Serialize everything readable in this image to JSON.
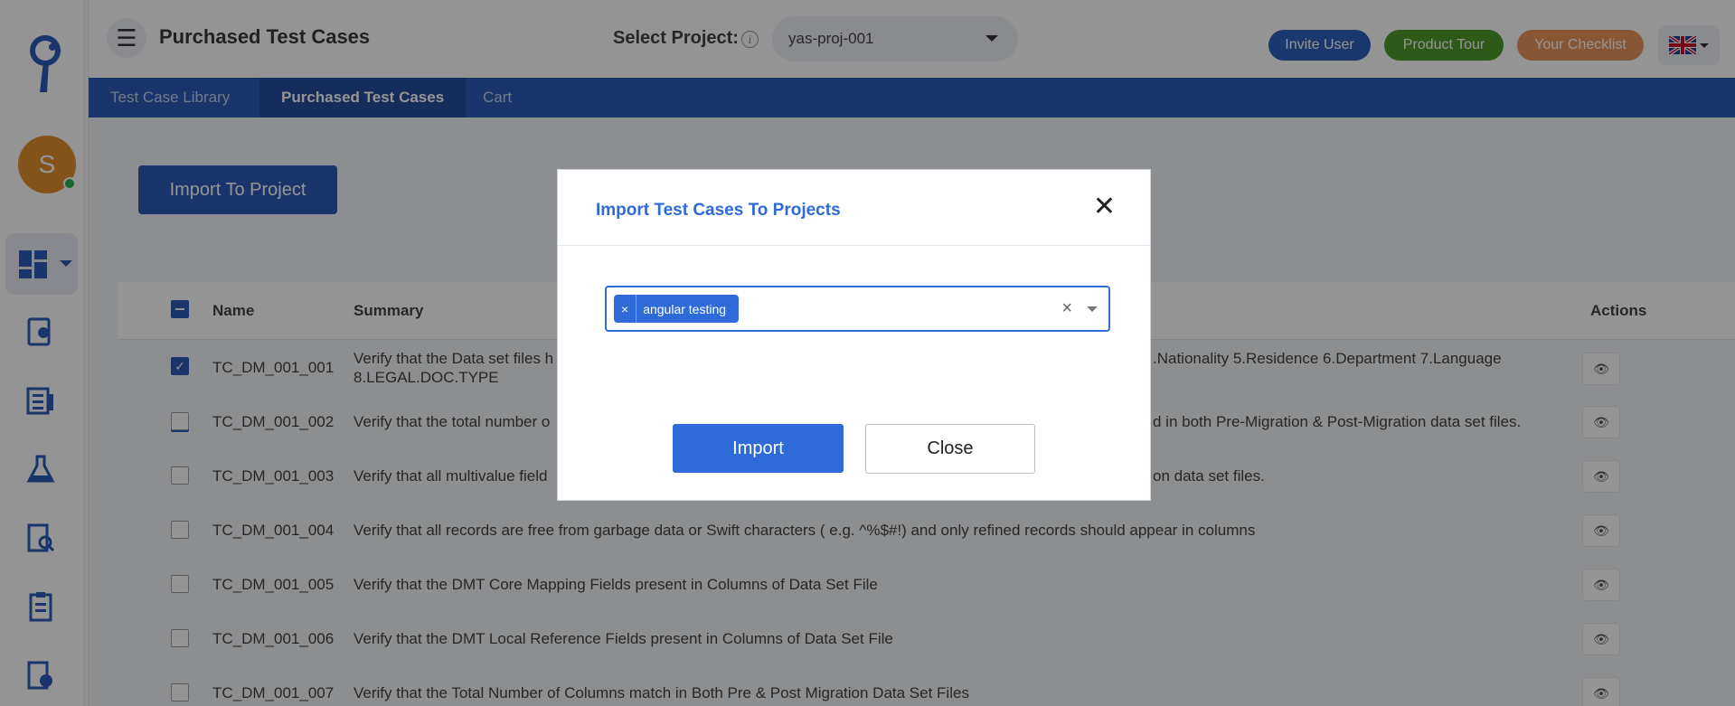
{
  "header": {
    "title": "Purchased Test Cases",
    "select_project_label": "Select Project:",
    "info_glyph": "i",
    "selected_project": "yas-proj-001",
    "invite_user": "Invite User",
    "product_tour": "Product Tour",
    "your_checklist": "Your Checklist",
    "language_flag": "uk-flag-icon"
  },
  "user": {
    "avatar_letter": "S",
    "status": "online"
  },
  "tabs": [
    {
      "label": "Test Case Library",
      "active": false
    },
    {
      "label": "Purchased Test Cases",
      "active": true
    },
    {
      "label": "Cart",
      "active": false
    }
  ],
  "content": {
    "import_to_project": "Import To Project",
    "columns": {
      "name": "Name",
      "summary": "Summary",
      "actions": "Actions"
    },
    "rows": [
      {
        "name": "TC_DM_001_001",
        "summary": "Verify that the Data set files h",
        "summary_tail": ".Nationality 5.Residence 6.Department 7.Language",
        "summary_line2": "8.LEGAL.DOC.TYPE",
        "checked": true
      },
      {
        "name": "TC_DM_001_002",
        "summary": "Verify that the total number o",
        "summary_tail": "d in both Pre-Migration & Post-Migration data set files.",
        "checked": false
      },
      {
        "name": "TC_DM_001_003",
        "summary": "Verify that all multivalue field",
        "summary_tail": "on data set files.",
        "checked": false
      },
      {
        "name": "TC_DM_001_004",
        "summary": "Verify that all records are free from garbage data or Swift characters ( e.g. ^%$#!) and only refined records should appear in columns",
        "checked": false
      },
      {
        "name": "TC_DM_001_005",
        "summary": "Verify that the DMT Core Mapping Fields present in Columns of Data Set File",
        "checked": false
      },
      {
        "name": "TC_DM_001_006",
        "summary": "Verify that the DMT Local Reference Fields present in Columns of Data Set File",
        "checked": false
      },
      {
        "name": "TC_DM_001_007",
        "summary": "Verify that the Total Number of Columns match in Both Pre & Post Migration Data Set Files",
        "checked": false
      }
    ]
  },
  "modal": {
    "title": "Import Test Cases To Projects",
    "close_glyph": "✕",
    "selected_chip": "angular testing",
    "chip_remove_glyph": "×",
    "clear_glyph": "×",
    "import_label": "Import",
    "close_label": "Close"
  },
  "colors": {
    "primary": "#2e5cb8",
    "modal_accent": "#2e6ad8",
    "tour_green": "#4e9a2b",
    "checklist_orange": "#e9955a",
    "avatar_orange": "#e4902d"
  }
}
